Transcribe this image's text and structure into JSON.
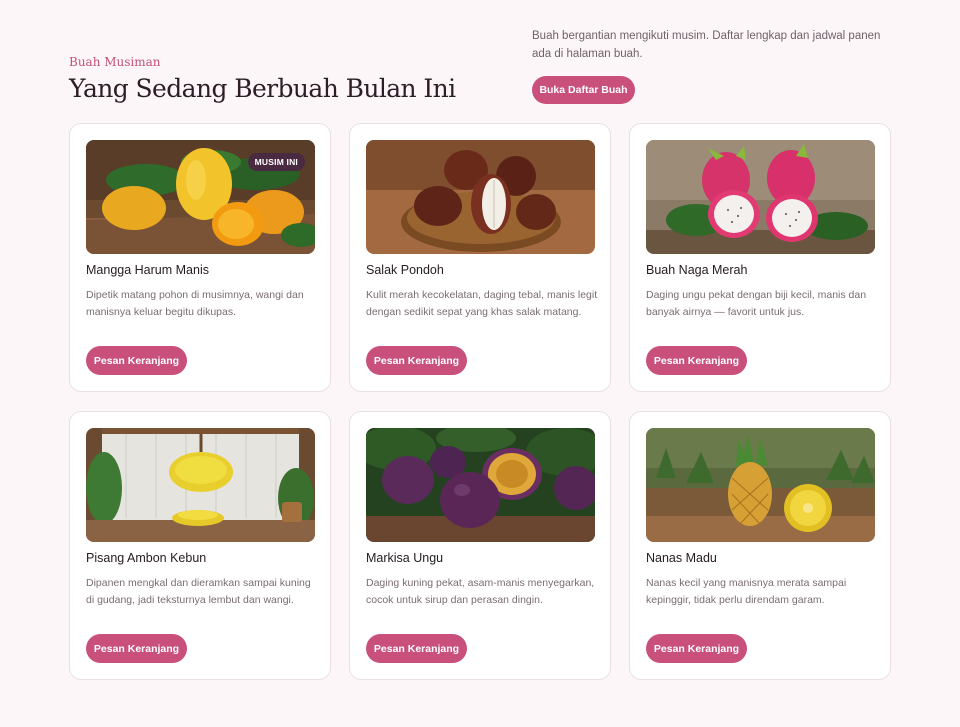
{
  "header": {
    "eyebrow": "Buah Musiman",
    "title": "Yang Sedang Berbuah Bulan Ini",
    "intro": "Buah bergantian mengikuti musim. Daftar lengkap dan jadwal panen ada di halaman buah.",
    "cta_label": "Buka Daftar Buah"
  },
  "colors": {
    "accent": "#c8507a",
    "badge": "#4a2a40",
    "background": "#fdf6f8"
  },
  "cards": [
    {
      "name": "Mangga Harum Manis",
      "desc": "Dipetik matang pohon di musimnya, wangi dan manisnya keluar begitu dikupas.",
      "button": "Pesan Keranjang",
      "badge": "MUSIM INI",
      "image": "mango-image"
    },
    {
      "name": "Salak Pondoh",
      "desc": "Kulit merah kecokelatan, daging tebal, manis legit dengan sedikit sepat yang khas salak matang.",
      "button": "Pesan Keranjang",
      "image": "salak-image"
    },
    {
      "name": "Buah Naga Merah",
      "desc": "Daging ungu pekat dengan biji kecil, manis dan banyak airnya — favorit untuk jus.",
      "button": "Pesan Keranjang",
      "image": "dragonfruit-image"
    },
    {
      "name": "Pisang Ambon Kebun",
      "desc": "Dipanen mengkal dan dieramkan sampai kuning di gudang, jadi teksturnya lembut dan wangi.",
      "button": "Pesan Keranjang",
      "image": "banana-image"
    },
    {
      "name": "Markisa Ungu",
      "desc": "Daging kuning pekat, asam-manis menyegarkan, cocok untuk sirup dan perasan dingin.",
      "button": "Pesan Keranjang",
      "image": "passionfruit-image"
    },
    {
      "name": "Nanas Madu",
      "desc": "Nanas kecil yang manisnya merata sampai kepinggir, tidak perlu direndam garam.",
      "button": "Pesan Keranjang",
      "image": "pineapple-image"
    }
  ]
}
